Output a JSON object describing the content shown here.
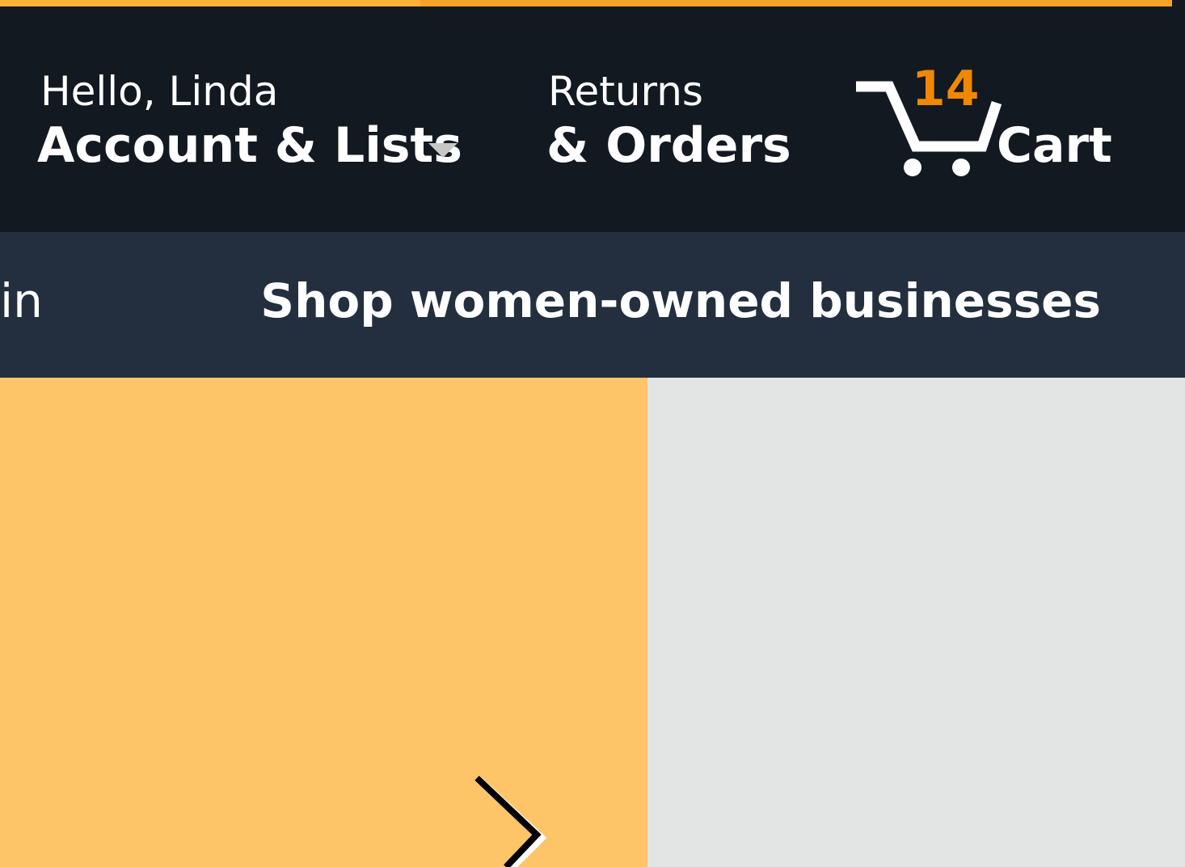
{
  "nav": {
    "account": {
      "greeting": "Hello, Linda",
      "label": "Account & Lists"
    },
    "returns": {
      "line1": "Returns",
      "line2": "& Orders"
    },
    "cart": {
      "count": "14",
      "label": "Cart",
      "icon": "cart-icon"
    }
  },
  "subnav": {
    "partial_item": "in",
    "promo": "Shop women-owned businesses"
  },
  "hero": {
    "next_icon": "chevron-right-icon"
  },
  "colors": {
    "nav_belt": "#131921",
    "nav_main": "#232f3e",
    "accent": "#f7a328",
    "cart_count": "#f08804",
    "hero_left": "#fec468",
    "hero_right": "#e3e5e4"
  }
}
